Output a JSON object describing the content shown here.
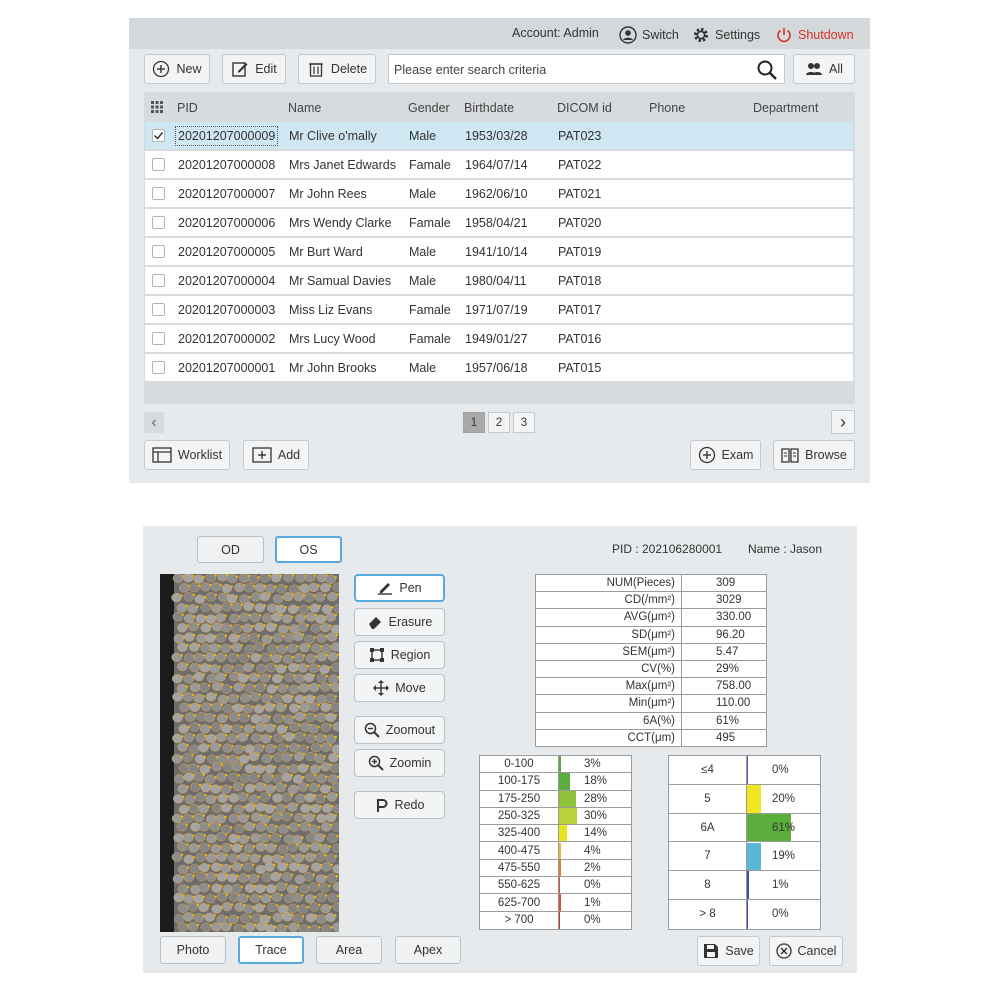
{
  "patient_list": {
    "topbar": {
      "account": "Account: Admin",
      "switch": "Switch",
      "settings": "Settings",
      "shutdown": "Shutdown"
    },
    "toolbar": {
      "new": "New",
      "edit": "Edit",
      "delete": "Delete",
      "search_placeholder": "Please enter search criteria",
      "all": "All"
    },
    "columns": [
      "PID",
      "Name",
      "Gender",
      "Birthdate",
      "DICOM id",
      "Phone",
      "Department"
    ],
    "rows": [
      {
        "pid": "20201207000009",
        "name": "Mr Clive o'mally",
        "gender": "Male",
        "birthdate": "1953/03/28",
        "dicom": "PAT023",
        "selected": true
      },
      {
        "pid": "20201207000008",
        "name": "Mrs Janet Edwards",
        "gender": "Famale",
        "birthdate": "1964/07/14",
        "dicom": "PAT022",
        "selected": false
      },
      {
        "pid": "20201207000007",
        "name": "Mr John Rees",
        "gender": "Male",
        "birthdate": "1962/06/10",
        "dicom": "PAT021",
        "selected": false
      },
      {
        "pid": "20201207000006",
        "name": "Mrs Wendy Clarke",
        "gender": "Famale",
        "birthdate": "1958/04/21",
        "dicom": "PAT020",
        "selected": false
      },
      {
        "pid": "20201207000005",
        "name": "Mr Burt Ward",
        "gender": "Male",
        "birthdate": "1941/10/14",
        "dicom": "PAT019",
        "selected": false
      },
      {
        "pid": "20201207000004",
        "name": "Mr Samual Davies",
        "gender": "Male",
        "birthdate": "1980/04/11",
        "dicom": "PAT018",
        "selected": false
      },
      {
        "pid": "20201207000003",
        "name": "Miss Liz Evans",
        "gender": "Famale",
        "birthdate": "1971/07/19",
        "dicom": "PAT017",
        "selected": false
      },
      {
        "pid": "20201207000002",
        "name": "Mrs Lucy Wood",
        "gender": "Famale",
        "birthdate": "1949/01/27",
        "dicom": "PAT016",
        "selected": false
      },
      {
        "pid": "20201207000001",
        "name": "Mr John Brooks",
        "gender": "Male",
        "birthdate": "1957/06/18",
        "dicom": "PAT015",
        "selected": false
      }
    ],
    "pages": [
      "1",
      "2",
      "3"
    ],
    "current_page": "1",
    "bottom": {
      "worklist": "Worklist",
      "add": "Add",
      "exam": "Exam",
      "browse": "Browse"
    }
  },
  "analysis": {
    "eye_tabs": [
      "OD",
      "OS"
    ],
    "active_eye": "OS",
    "pid_label": "PID : 202106280001",
    "name_label": "Name : Jason",
    "tools": [
      "Pen",
      "Erasure",
      "Region",
      "Move",
      "Zoomout",
      "Zoomin",
      "Redo"
    ],
    "active_tool": "Pen",
    "stats": [
      {
        "k": "NUM(Pieces)",
        "v": "309"
      },
      {
        "k": "CD(/mm²)",
        "v": "3029"
      },
      {
        "k": "AVG(μm²)",
        "v": "330.00"
      },
      {
        "k": "SD(μm²)",
        "v": "96.20"
      },
      {
        "k": "SEM(μm²)",
        "v": "5.47"
      },
      {
        "k": "CV(%)",
        "v": "29%"
      },
      {
        "k": "Max(μm²)",
        "v": "758.00"
      },
      {
        "k": "Min(μm²)",
        "v": "110.00"
      },
      {
        "k": "6A(%)",
        "v": "61%"
      },
      {
        "k": "CCT(μm)",
        "v": "495"
      }
    ],
    "area_hist": [
      {
        "label": "0-100",
        "pct": "3%",
        "frac": 0.03,
        "color": "#5cae3c"
      },
      {
        "label": "100-175",
        "pct": "18%",
        "frac": 0.18,
        "color": "#5cae3c"
      },
      {
        "label": "175-250",
        "pct": "28%",
        "frac": 0.28,
        "color": "#8fc13a"
      },
      {
        "label": "250-325",
        "pct": "30%",
        "frac": 0.3,
        "color": "#b8d43a"
      },
      {
        "label": "325-400",
        "pct": "14%",
        "frac": 0.14,
        "color": "#e8e51e"
      },
      {
        "label": "400-475",
        "pct": "4%",
        "frac": 0.04,
        "color": "#f0b72a"
      },
      {
        "label": "475-550",
        "pct": "2%",
        "frac": 0.02,
        "color": "#ea7b26"
      },
      {
        "label": "550-625",
        "pct": "0%",
        "frac": 0.0,
        "color": "#e04a2a"
      },
      {
        "label": "625-700",
        "pct": "1%",
        "frac": 0.01,
        "color": "#e04a2a"
      },
      {
        "label": "> 700",
        "pct": "0%",
        "frac": 0.0,
        "color": "#c0392b"
      }
    ],
    "side_hist": [
      {
        "label": "≤4",
        "pct": "0%",
        "frac": 0.0,
        "color": "#7b4bb8"
      },
      {
        "label": "5",
        "pct": "20%",
        "frac": 0.2,
        "color": "#f0e51e"
      },
      {
        "label": "6A",
        "pct": "61%",
        "frac": 0.61,
        "color": "#5cae3c"
      },
      {
        "label": "7",
        "pct": "19%",
        "frac": 0.19,
        "color": "#5ab7d6"
      },
      {
        "label": "8",
        "pct": "1%",
        "frac": 0.01,
        "color": "#3a4fa8"
      },
      {
        "label": "> 8",
        "pct": "0%",
        "frac": 0.0,
        "color": "#3a4fa8"
      }
    ],
    "view_tabs": [
      "Photo",
      "Trace",
      "Area",
      "Apex"
    ],
    "active_view": "Trace",
    "save": "Save",
    "cancel": "Cancel"
  }
}
